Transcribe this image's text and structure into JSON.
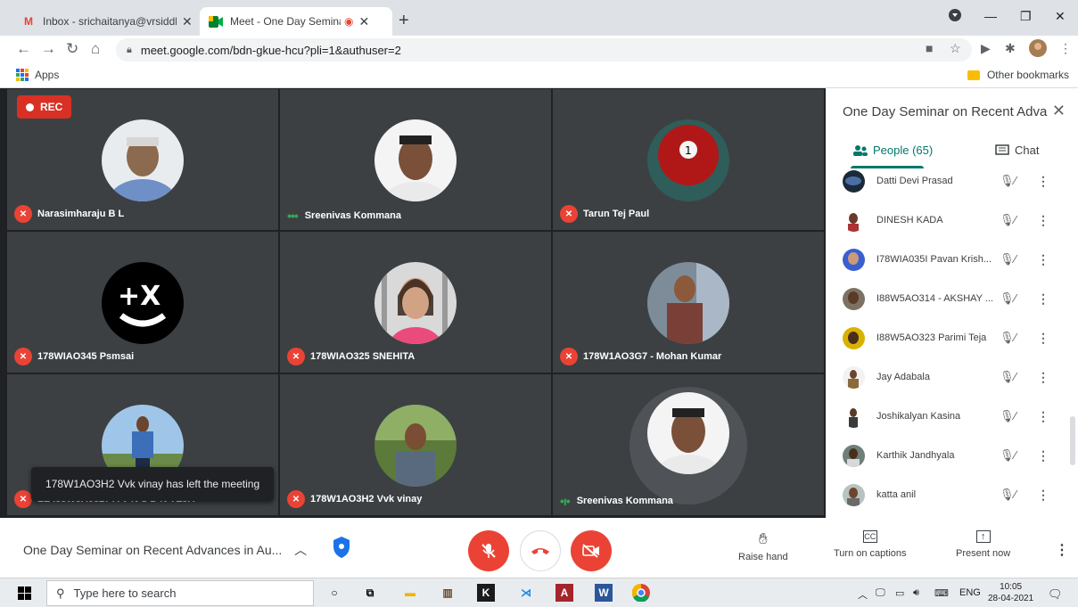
{
  "browser": {
    "tabs": [
      {
        "title": "Inbox - srichaitanya@vrsiddharth"
      },
      {
        "title": "Meet - One Day Seminar on"
      }
    ],
    "url": "meet.google.com/bdn-gkue-hcu?pli=1&authuser=2",
    "bookmarks": {
      "apps": "Apps",
      "other": "Other bookmarks"
    }
  },
  "meet": {
    "rec_label": "REC",
    "tiles": [
      {
        "name": "Narasimharaju B L",
        "mic": "muted"
      },
      {
        "name": "Sreenivas Kommana",
        "mic": "speaking"
      },
      {
        "name": "Tarun Tej Paul",
        "mic": "muted"
      },
      {
        "name": "178WIAO345 Psmsai",
        "mic": "muted"
      },
      {
        "name": "178WIAO325 SNEHITA",
        "mic": "muted"
      },
      {
        "name": "178W1AO3G7 - Mohan Kumar",
        "mic": "muted"
      },
      {
        "name": "LE I88W5A0327 A V N S D N TEJA",
        "mic": "muted"
      },
      {
        "name": "178W1AO3H2 Vvk vinay",
        "mic": "muted"
      },
      {
        "name": "Sreenivas Kommana",
        "mic": "speaking"
      }
    ],
    "toast": "178W1AO3H2 Vvk vinay has left the meeting"
  },
  "panel": {
    "title": "One Day Seminar on Recent Adva...",
    "people_tab": "People (65)",
    "chat_tab": "Chat",
    "people": [
      {
        "name": "Datti Devi Prasad"
      },
      {
        "name": "DINESH KADA"
      },
      {
        "name": "I78WIA035I Pavan Krish..."
      },
      {
        "name": "I88W5AO314 - AKSHAY ..."
      },
      {
        "name": "I88W5AO323 Parimi Teja"
      },
      {
        "name": "Jay Adabala"
      },
      {
        "name": "Joshikalyan Kasina"
      },
      {
        "name": "Karthik Jandhyala"
      },
      {
        "name": "katta anil"
      }
    ]
  },
  "bottom": {
    "meeting_name": "One Day Seminar on Recent Advances in Au...",
    "raise_hand": "Raise hand",
    "captions": "Turn on captions",
    "present": "Present now"
  },
  "taskbar": {
    "search_placeholder": "Type here to search",
    "lang": "ENG",
    "time": "10:05",
    "date": "28-04-2021"
  }
}
